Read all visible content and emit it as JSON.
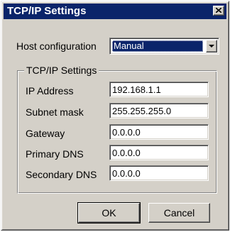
{
  "window": {
    "title": "TCP/IP Settings",
    "close_icon": "close-icon"
  },
  "host_configuration": {
    "label": "Host configuration",
    "selected": "Manual"
  },
  "group": {
    "title": "TCP/IP Settings",
    "fields": [
      {
        "label": "IP Address",
        "value": "192.168.1.1"
      },
      {
        "label": "Subnet mask",
        "value": "255.255.255.0"
      },
      {
        "label": "Gateway",
        "value": "0.0.0.0"
      },
      {
        "label": "Primary DNS",
        "value": "0.0.0.0"
      },
      {
        "label": "Secondary DNS",
        "value": "0.0.0.0"
      }
    ]
  },
  "buttons": {
    "ok": "OK",
    "cancel": "Cancel"
  },
  "colors": {
    "title_bar": "#0a246a",
    "face": "#d4d0c8",
    "selection": "#0a246a"
  }
}
